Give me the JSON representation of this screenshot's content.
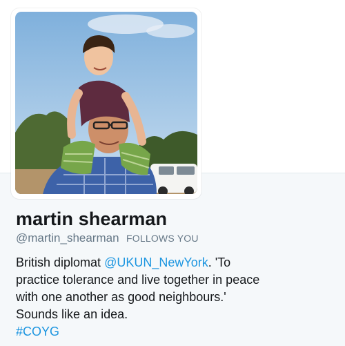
{
  "profile": {
    "name": "martin shearman",
    "handle": "@martin_shearman",
    "follows_you": "FOLLOWS YOU",
    "bio": {
      "text1": "British diplomat ",
      "mention": "@UKUN_NewYork",
      "text2": ". 'To practice tolerance and live together in peace with one another as good neighbours.' Sounds like an idea.",
      "hashtag": "#COYG"
    }
  },
  "colors": {
    "link": "#1b95e0",
    "text": "#14171a",
    "secondary": "#657786",
    "profile_background": "#f5f8fa"
  }
}
